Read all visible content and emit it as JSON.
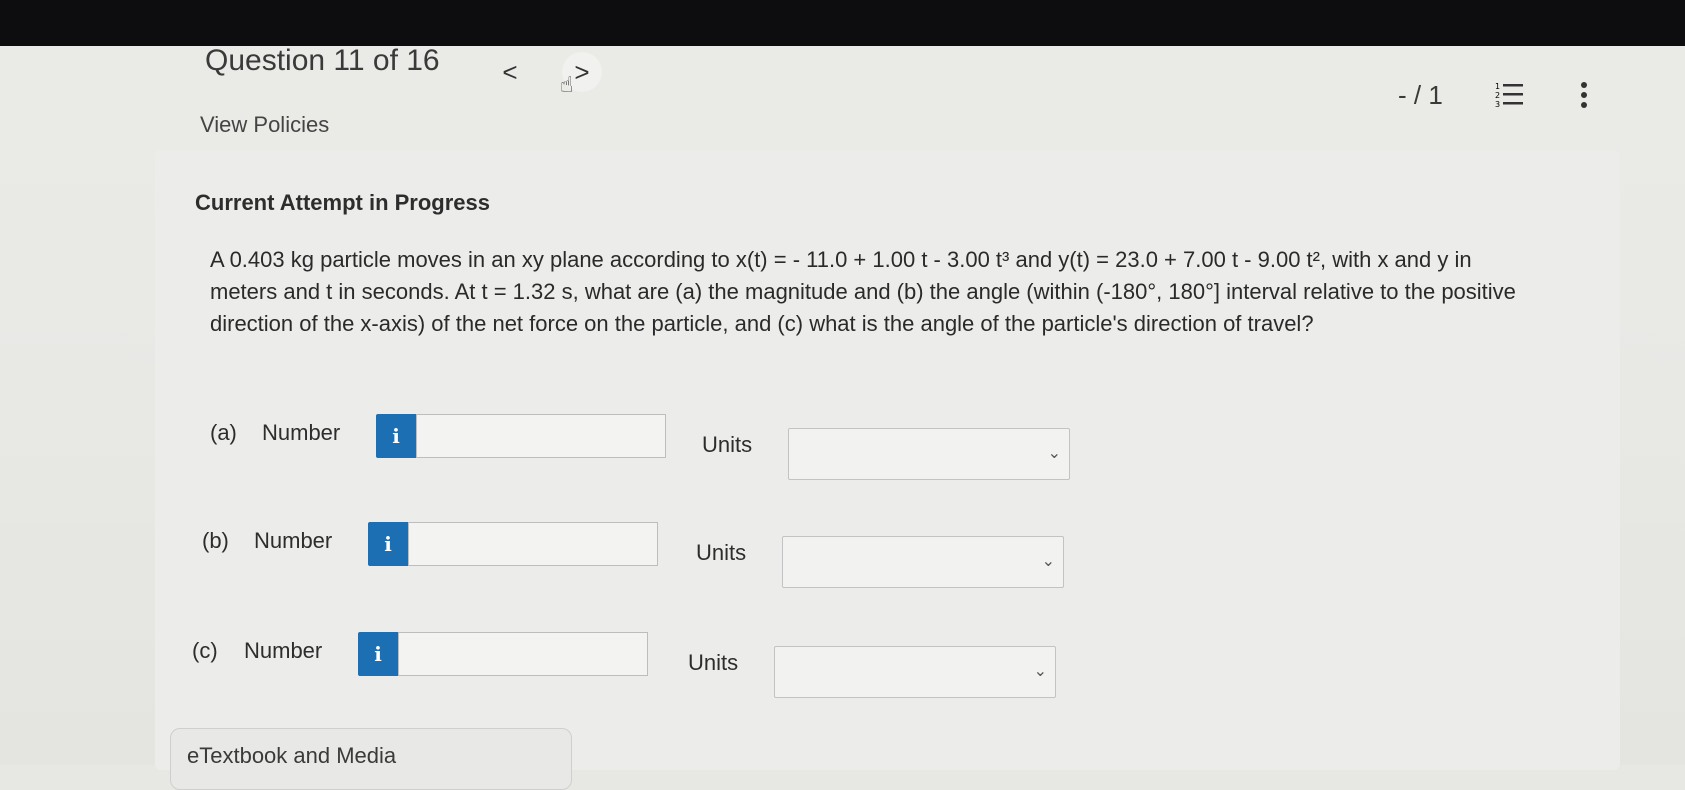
{
  "header": {
    "question_label": "Question 11 of 16",
    "prev": "<",
    "next": ">",
    "view_policies": "View Policies",
    "score": "- / 1"
  },
  "attempt_label": "Current Attempt in Progress",
  "problem": {
    "line1": "A 0.403 kg particle moves in an xy plane according to x(t) = - 11.0 + 1.00 t - 3.00 t³ and y(t) = 23.0 + 7.00 t - 9.00 t², with x and y in",
    "line2": "meters and t in seconds. At t = 1.32 s, what are (a) the magnitude and (b) the angle (within (-180°, 180°] interval relative to the positive",
    "line3": "direction of the x-axis) of the net force on the particle, and (c) what is the angle of the particle's direction of travel?"
  },
  "parts": [
    {
      "label": "(a)",
      "number_label": "Number",
      "info": "i",
      "value": "",
      "units_label": "Units",
      "units_value": ""
    },
    {
      "label": "(b)",
      "number_label": "Number",
      "info": "i",
      "value": "",
      "units_label": "Units",
      "units_value": ""
    },
    {
      "label": "(c)",
      "number_label": "Number",
      "info": "i",
      "value": "",
      "units_label": "Units",
      "units_value": ""
    }
  ],
  "etextbook_label": "eTextbook and Media",
  "colors": {
    "info_button": "#1c6fb3",
    "topbar": "#0d0d0f"
  }
}
